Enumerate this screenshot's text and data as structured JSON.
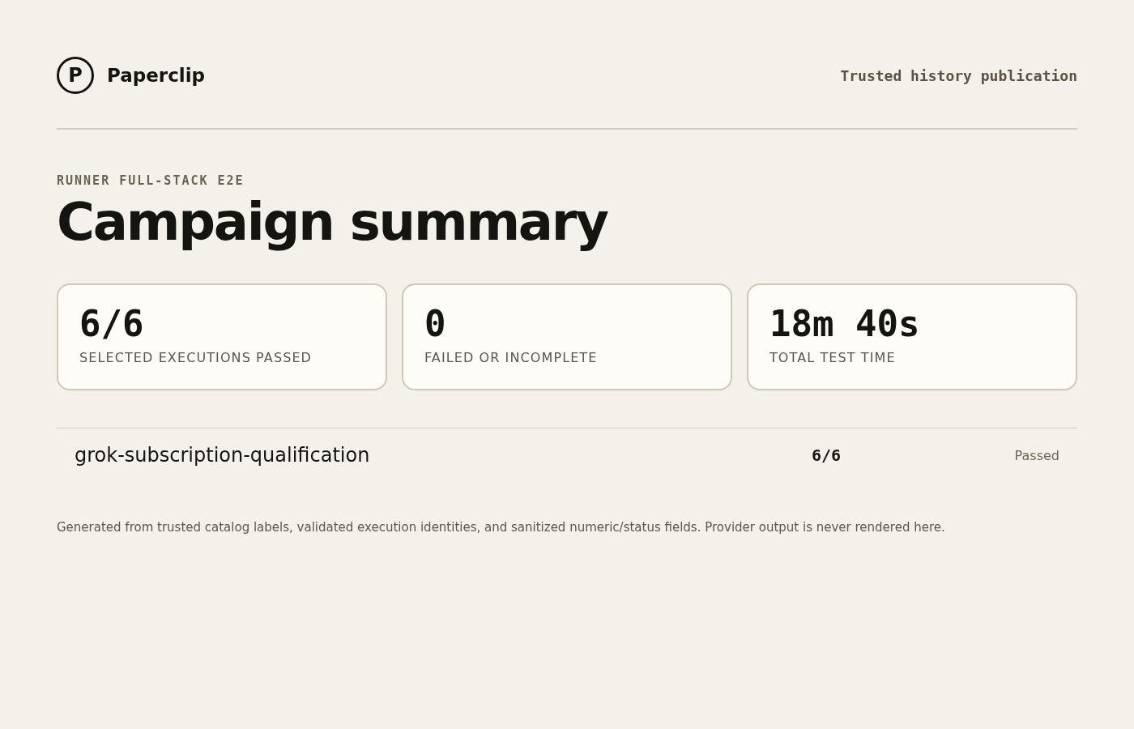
{
  "header": {
    "logo_mark": "P",
    "brand": "Paperclip",
    "tagline": "Trusted history publication"
  },
  "eyebrow": "RUNNER FULL-STACK E2E",
  "title": "Campaign summary",
  "stats": [
    {
      "value": "6/6",
      "label": "SELECTED EXECUTIONS PASSED"
    },
    {
      "value": "0",
      "label": "FAILED OR INCOMPLETE"
    },
    {
      "value": "18m 40s",
      "label": "TOTAL TEST TIME"
    }
  ],
  "results": [
    {
      "name": "grok-subscription-qualification",
      "count": "6/6",
      "status": "Passed"
    }
  ],
  "footnote": "Generated from trusted catalog labels, validated execution identities, and sanitized numeric/status fields. Provider output is never rendered here."
}
